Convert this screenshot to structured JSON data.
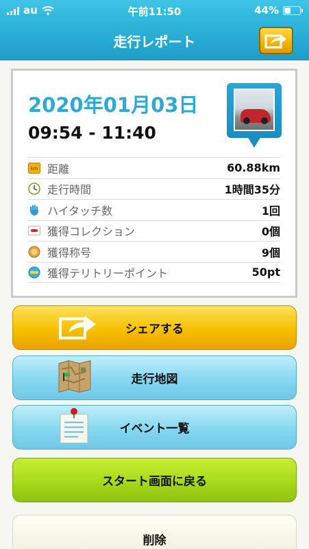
{
  "status_bar": {
    "carrier": "au",
    "time": "午前11:50",
    "battery_percent": "44%",
    "battery_level": 0.44
  },
  "header": {
    "title": "走行レポート"
  },
  "report": {
    "date": "2020年01月03日",
    "time_range": "09:54 - 11:40",
    "stats": [
      {
        "icon": "km-icon",
        "label": "距離",
        "value": "60.88km"
      },
      {
        "icon": "clock-icon",
        "label": "走行時間",
        "value": "1時間35分"
      },
      {
        "icon": "high-five-icon",
        "label": "ハイタッチ数",
        "value": "1回"
      },
      {
        "icon": "collection-card-icon",
        "label": "獲得コレクション",
        "value": "0個"
      },
      {
        "icon": "medal-icon",
        "label": "獲得称号",
        "value": "9個"
      },
      {
        "icon": "territory-point-icon",
        "label": "獲得テリトリーポイント",
        "value": "50pt"
      }
    ]
  },
  "buttons": {
    "share": "シェアする",
    "map": "走行地図",
    "events": "イベント一覧",
    "back_to_start": "スタート画面に戻る",
    "delete": "削除"
  },
  "colors": {
    "header": "#31b6dc",
    "date": "#2fa8d4",
    "share_button": "#f7bf00",
    "blue_button": "#86d7f0",
    "green_button": "#a8d91a"
  }
}
